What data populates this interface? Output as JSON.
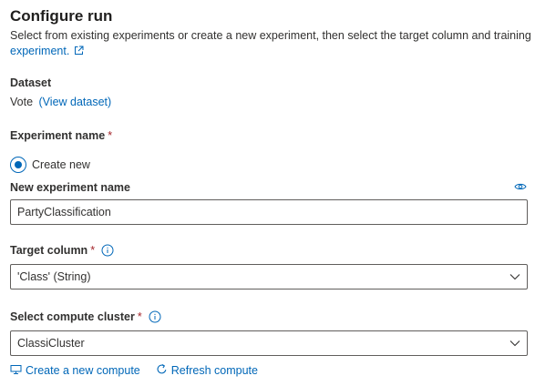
{
  "header": {
    "title": "Configure run",
    "description": "Select from existing experiments or create a new experiment, then select the target column and training",
    "description_link": "experiment."
  },
  "dataset": {
    "label": "Dataset",
    "name": "Vote",
    "view_link": "(View dataset)"
  },
  "experiment": {
    "label": "Experiment name",
    "required_mark": "*",
    "option_create_new": "Create new",
    "new_name_label": "New experiment name",
    "new_name_value": "PartyClassification"
  },
  "target_column": {
    "label": "Target column",
    "required_mark": "*",
    "value": "'Class' (String)"
  },
  "compute": {
    "label": "Select compute cluster",
    "required_mark": "*",
    "value": "ClassiCluster",
    "create_link": "Create a new compute",
    "refresh_link": "Refresh compute"
  },
  "colors": {
    "accent": "#0067b8",
    "required": "#a4262c",
    "text": "#323130",
    "border": "#605e5c"
  },
  "icons": {
    "external_link": "open-in-new-window-icon",
    "show_value": "eye-icon",
    "info": "info-icon",
    "chevron": "chevron-down-icon",
    "compute": "compute-icon",
    "refresh": "refresh-icon"
  }
}
